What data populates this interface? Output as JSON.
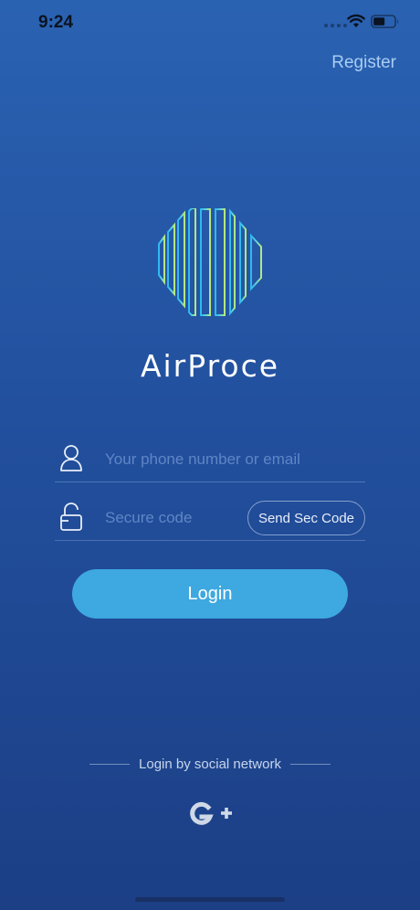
{
  "status_bar": {
    "time": "9:24"
  },
  "header": {
    "register_label": "Register"
  },
  "brand": {
    "name": "AirProce"
  },
  "form": {
    "account_placeholder": "Your phone number or email",
    "account_value": "",
    "code_placeholder": "Secure code",
    "code_value": "",
    "send_code_label": "Send Sec Code",
    "login_label": "Login"
  },
  "social": {
    "label": "Login by social network",
    "providers": [
      {
        "icon": "google-plus-icon"
      }
    ]
  },
  "colors": {
    "background_top": "#2a62b2",
    "background_bottom": "#1c3f86",
    "accent": "#3ea8e0",
    "link": "#a9cdf4"
  }
}
